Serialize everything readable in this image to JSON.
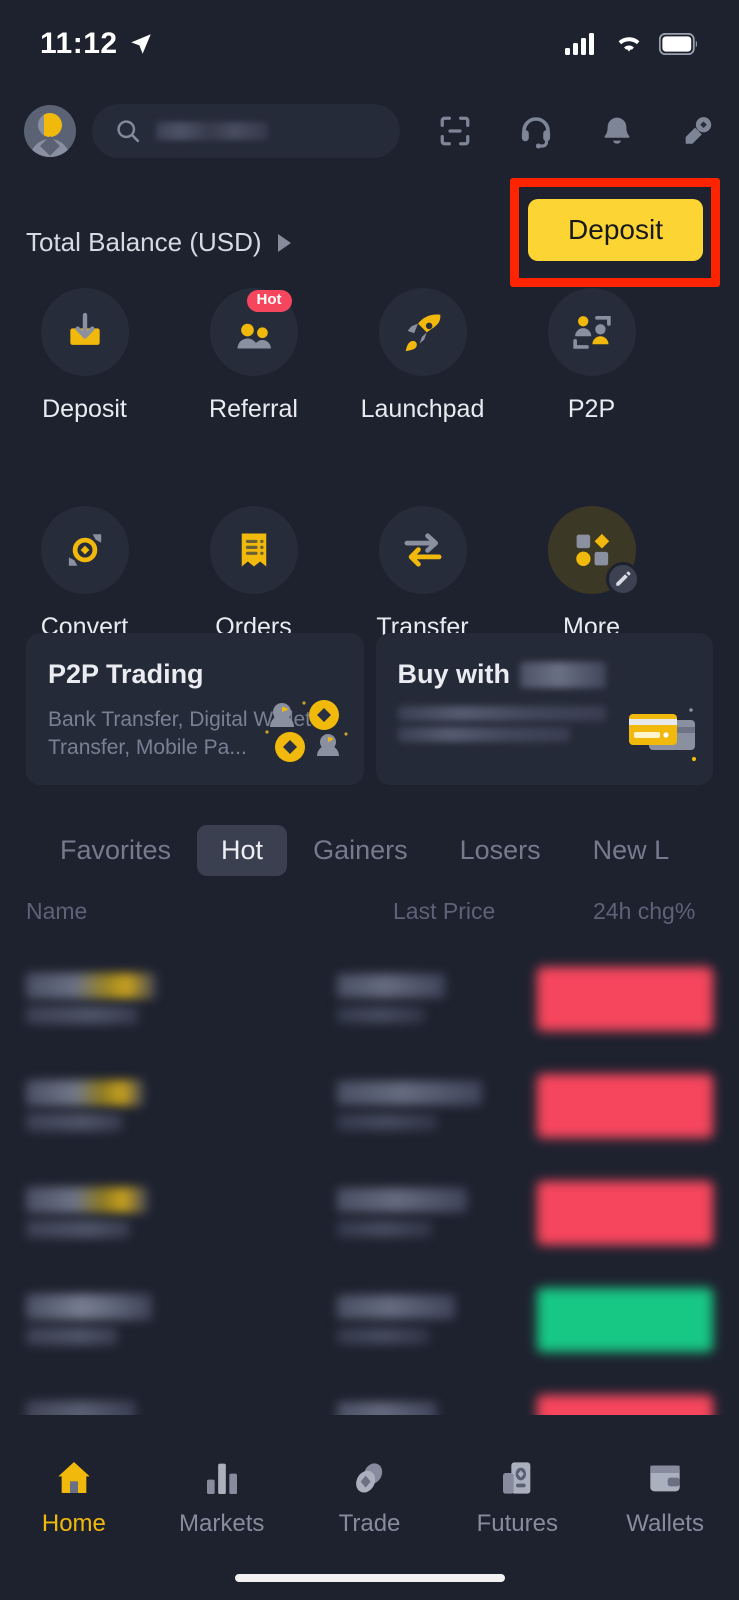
{
  "status_bar": {
    "time": "11:12",
    "location_icon": "location-arrow-icon",
    "signal_icon": "cellular-signal-icon",
    "wifi_icon": "wifi-icon",
    "battery_icon": "battery-icon"
  },
  "top_bar": {
    "avatar": "user-avatar",
    "search": {
      "placeholder": "",
      "value": "",
      "icon": "search-icon",
      "blurred": true
    },
    "icons": [
      {
        "name": "qr-scan-icon",
        "label": "Scan"
      },
      {
        "name": "headset-support-icon",
        "label": "Support"
      },
      {
        "name": "bell-notification-icon",
        "label": "Notifications"
      },
      {
        "name": "signature-pen-icon",
        "label": "Sign"
      }
    ]
  },
  "balance": {
    "label": "Total Balance (USD)",
    "caret": "expand-caret-icon",
    "deposit_label": "Deposit",
    "highlight_color": "#FF2400",
    "accent_color": "#FCD535"
  },
  "quick_actions": [
    {
      "label": "Deposit",
      "icon": "deposit-tray-icon",
      "badge": null
    },
    {
      "label": "Referral",
      "icon": "referral-people-icon",
      "badge": "Hot"
    },
    {
      "label": "Launchpad",
      "icon": "rocket-icon",
      "badge": null
    },
    {
      "label": "P2P",
      "icon": "p2p-people-icon",
      "badge": null
    },
    {
      "label": "Convert",
      "icon": "convert-coin-icon",
      "badge": null
    },
    {
      "label": "Orders",
      "icon": "orders-receipt-icon",
      "badge": null
    },
    {
      "label": "Transfer",
      "icon": "transfer-arrows-icon",
      "badge": null
    },
    {
      "label": "More",
      "icon": "more-shapes-icon",
      "badge": "edit-pencil-icon"
    }
  ],
  "promo_cards": [
    {
      "title": "P2P Trading",
      "title_blurred": false,
      "subtitle": "Bank Transfer, Digital Wallet Transfer, Mobile Pa...",
      "subtitle_blurred": false,
      "art": "p2p-people-coins-art"
    },
    {
      "title": "Buy with",
      "title_blurred": true,
      "subtitle": "",
      "subtitle_blurred": true,
      "art": "credit-cards-art"
    }
  ],
  "market": {
    "tabs": [
      {
        "label": "Favorites",
        "active": false
      },
      {
        "label": "Hot",
        "active": true
      },
      {
        "label": "Gainers",
        "active": false
      },
      {
        "label": "Losers",
        "active": false
      },
      {
        "label": "New L",
        "active": false
      }
    ],
    "columns": [
      "Name",
      "Last Price",
      "24h chg%"
    ],
    "rows": [
      {
        "name_blurred": true,
        "name_width": 130,
        "has_logo": true,
        "price_blurred": true,
        "price_width": 108,
        "price2_width": 88,
        "chg_direction": "down",
        "chg_color": "#F6465D"
      },
      {
        "name_blurred": true,
        "name_width": 118,
        "has_logo": true,
        "price_blurred": true,
        "price_width": 145,
        "price2_width": 100,
        "chg_direction": "down",
        "chg_color": "#F6465D"
      },
      {
        "name_blurred": true,
        "name_width": 122,
        "has_logo": true,
        "price_blurred": true,
        "price_width": 130,
        "price2_width": 95,
        "chg_direction": "down",
        "chg_color": "#F6465D"
      },
      {
        "name_blurred": true,
        "name_width": 126,
        "has_logo": false,
        "price_blurred": true,
        "price_width": 118,
        "price2_width": 92,
        "chg_direction": "up",
        "chg_color": "#17C784"
      },
      {
        "name_blurred": true,
        "name_width": 110,
        "has_logo": false,
        "price_blurred": true,
        "price_width": 100,
        "price2_width": 80,
        "chg_direction": "down",
        "chg_color": "#F6465D"
      }
    ]
  },
  "bottom_nav": [
    {
      "label": "Home",
      "icon": "home-icon",
      "active": true
    },
    {
      "label": "Markets",
      "icon": "bar-chart-icon",
      "active": false
    },
    {
      "label": "Trade",
      "icon": "trade-coins-icon",
      "active": false
    },
    {
      "label": "Futures",
      "icon": "futures-doc-icon",
      "active": false
    },
    {
      "label": "Wallets",
      "icon": "wallet-icon",
      "active": false
    }
  ]
}
